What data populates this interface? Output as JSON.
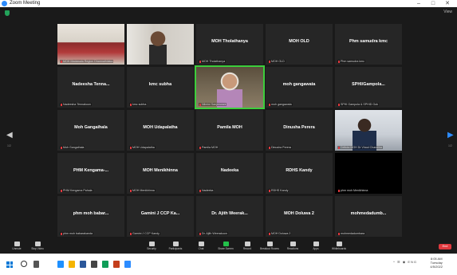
{
  "window": {
    "title": "Zoom Meeting",
    "controls": [
      "–",
      "□",
      "✕"
    ],
    "view_label": "View"
  },
  "colors": {
    "active_speaker": "#3cce3c",
    "tile_bg": "#262626",
    "end_button": "#e0393e",
    "accent": "#2D8CFF"
  },
  "pagination": {
    "left": "1/2",
    "right": "1/2"
  },
  "tiles": [
    {
      "name": "",
      "label": "MOH Madawala Region Dharmathilaka",
      "video": "room"
    },
    {
      "name": "",
      "label": "",
      "video": "person-room"
    },
    {
      "name": "MOH Tholathanya",
      "label": "MOH Tholathanya"
    },
    {
      "name": "MOH OLD",
      "label": "MOH OLD"
    },
    {
      "name": "Phm samudra kmc",
      "label": "Phm samudra kmc"
    },
    {
      "name": "Nadeesha Tenna...",
      "label": "Nadeesha Tennakoon"
    },
    {
      "name": "kmc subha",
      "label": "kmc subha"
    },
    {
      "name": "",
      "label": "Nilmini Sanjeewani",
      "video": "speaker",
      "active": true
    },
    {
      "name": "moh gangawata",
      "label": "moh gangawata"
    },
    {
      "name": "SPHI/Gampola...",
      "label": "SPHI Gampola & SPHID Gok"
    },
    {
      "name": "Moh Gangaihala",
      "label": "Moh Gangaihala"
    },
    {
      "name": "MOH Udapalatha",
      "label": "MOH Udapalatha"
    },
    {
      "name": "Pamila MOH",
      "label": "Pamila MOH"
    },
    {
      "name": "Dinusha Perera",
      "label": "Dinusha Perera"
    },
    {
      "name": "",
      "label": "Deltota MOH Dr Vinod Chandika",
      "video": "person-office"
    },
    {
      "name": "PHM Kengama-...",
      "label": "PHM Kengama Pahala"
    },
    {
      "name": "MOH Menikhinna",
      "label": "MOH Menikhinna"
    },
    {
      "name": "Nadeeka",
      "label": "Nadeeka"
    },
    {
      "name": "RDHS Kandy",
      "label": "RDHS Kandy"
    },
    {
      "name": "",
      "label": "phm moh Menikhinna",
      "video": "black"
    },
    {
      "name": "phm moh babar...",
      "label": "phm moh babarakanda"
    },
    {
      "name": "Gamini J CCP Ka...",
      "label": "Gamini J CCP Kandy"
    },
    {
      "name": "Dr. Ajith Weerak...",
      "label": "Dr. Ajith Weerakoon"
    },
    {
      "name": "MOH Doluwa 2",
      "label": "MOH Doluwa 2"
    },
    {
      "name": "mohmedadumb...",
      "label": "mohmedadumbara"
    }
  ],
  "toolbar": {
    "items": [
      {
        "label": "Unmute",
        "icon": "microphone-icon"
      },
      {
        "label": "Stop Video",
        "icon": "video-camera-icon"
      },
      {
        "label": "Security",
        "icon": "shield-icon"
      },
      {
        "label": "Participants",
        "icon": "participants-icon"
      },
      {
        "label": "Chat",
        "icon": "chat-icon"
      },
      {
        "label": "Share Screen",
        "icon": "share-screen-icon"
      },
      {
        "label": "Record",
        "icon": "record-icon"
      },
      {
        "label": "Breakout Rooms",
        "icon": "breakout-rooms-icon"
      },
      {
        "label": "Reactions",
        "icon": "reactions-icon"
      },
      {
        "label": "Apps",
        "icon": "apps-icon"
      },
      {
        "label": "Whiteboards",
        "icon": "whiteboard-icon"
      }
    ],
    "participant_count": "25",
    "end_label": "End"
  },
  "taskbar": {
    "time": "8:05 AM",
    "day": "Tuesday",
    "date": "4/5/2022",
    "tray": "^ ☰ ◉ ENG"
  }
}
